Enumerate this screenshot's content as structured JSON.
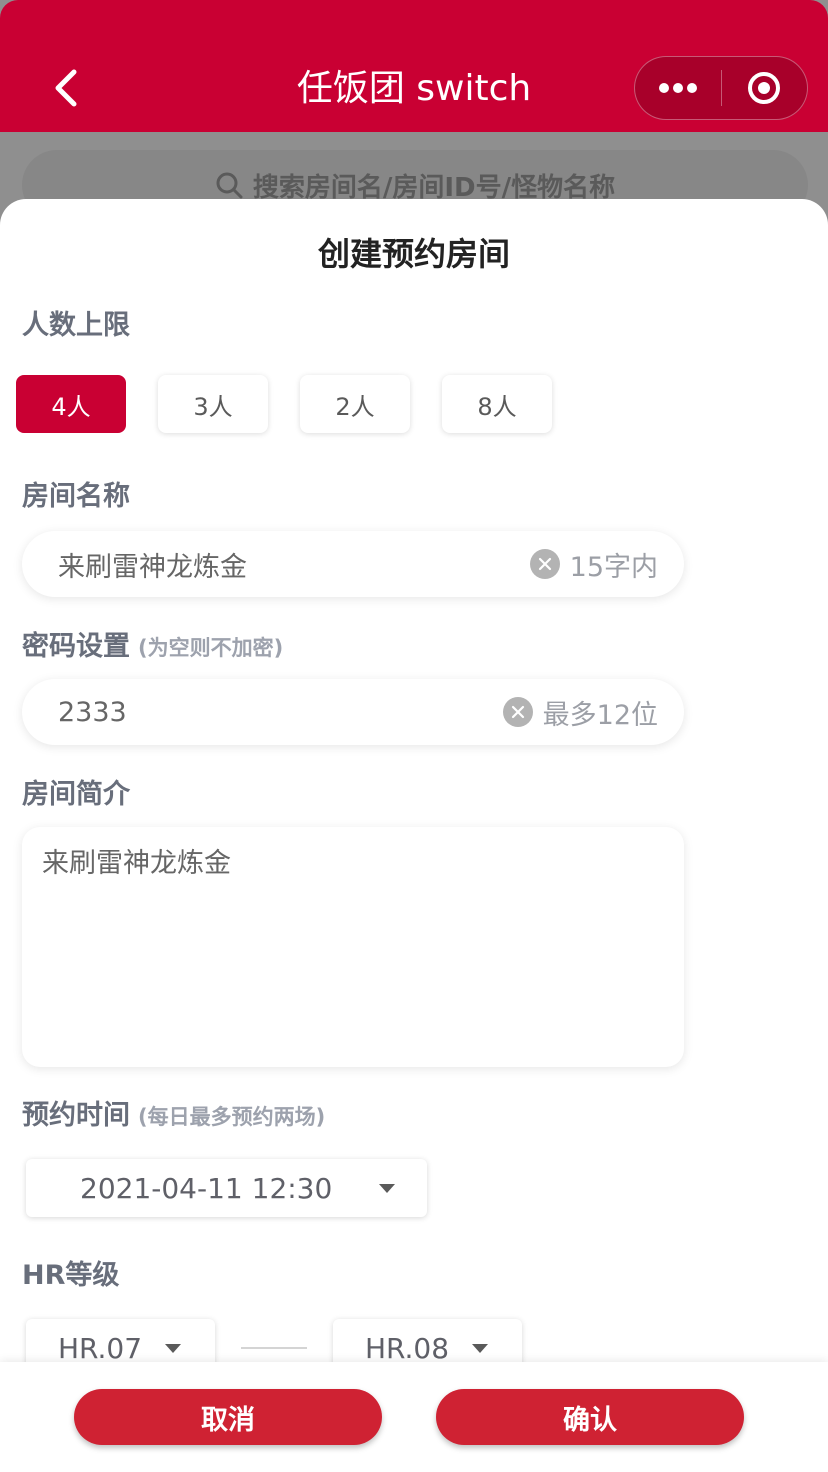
{
  "header": {
    "title": "任饭团 switch",
    "back_icon": "chevron-left-icon",
    "more_icon": "more-dots-icon",
    "target_icon": "target-icon",
    "color": "#c90033"
  },
  "background_search": {
    "placeholder": "搜索房间名/房间ID号/怪物名称"
  },
  "sheet": {
    "title": "创建预约房间",
    "capacity": {
      "label": "人数上限",
      "options": [
        "4人",
        "3人",
        "2人",
        "8人"
      ],
      "selected": "4人"
    },
    "room_name": {
      "label": "房间名称",
      "value": "来刷雷神龙炼金",
      "hint": "15字内"
    },
    "password": {
      "label": "密码设置",
      "sub_label": "(为空则不加密)",
      "value": "2333",
      "hint": "最多12位"
    },
    "intro": {
      "label": "房间简介",
      "value": "来刷雷神龙炼金"
    },
    "schedule": {
      "label": "预约时间",
      "sub_label": "(每日最多预约两场)",
      "value": "2021-04-11 12:30"
    },
    "hr": {
      "label": "HR等级",
      "min": "HR.07",
      "max": "HR.08"
    }
  },
  "footer": {
    "cancel_label": "取消",
    "confirm_label": "确认",
    "button_color": "#cf2233"
  }
}
